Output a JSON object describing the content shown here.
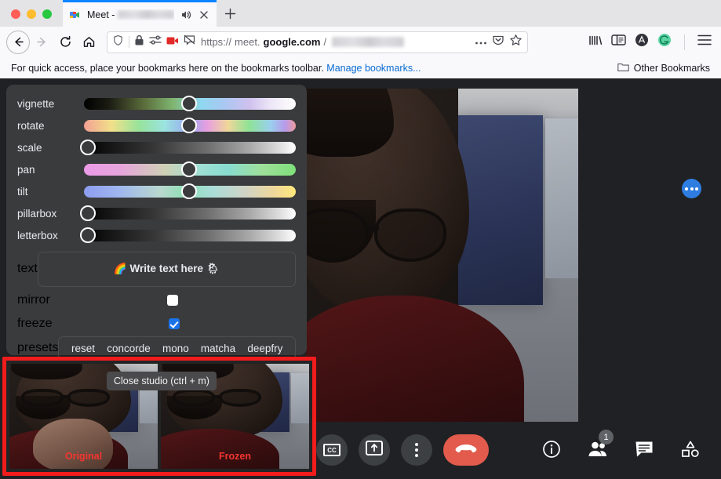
{
  "browser": {
    "tab": {
      "title": "Meet - ",
      "favicon": "google-meet-icon",
      "has_audio_playing": true
    },
    "newtab_label": "+",
    "url": {
      "scheme": "https://",
      "host_pre": "meet.",
      "host_bold": "google.com",
      "path": "/"
    },
    "url_icons": [
      "shield-icon",
      "lock-icon",
      "permissions-icon",
      "camera-blocked-icon",
      "popup-blocked-icon"
    ],
    "url_right_icons": [
      "more-icon",
      "pocket-icon",
      "bookmark-star-icon"
    ],
    "toolbar_icons": [
      "library-icon",
      "sidebar-icon",
      "account-icon",
      "grammarly-icon",
      "hamburger-menu-icon"
    ],
    "bookmarks_bar": {
      "text": "For quick access, place your bookmarks here on the bookmarks toolbar.",
      "link": "Manage bookmarks...",
      "other_bookmarks": "Other Bookmarks"
    }
  },
  "studio": {
    "sliders": [
      {
        "label": "vignette",
        "gradient": "g-vignette",
        "thumb_pct": 50
      },
      {
        "label": "rotate",
        "gradient": "g-rotate",
        "thumb_pct": 50
      },
      {
        "label": "scale",
        "gradient": "g-gray",
        "thumb_pct": 0
      },
      {
        "label": "pan",
        "gradient": "g-pan",
        "thumb_pct": 50
      },
      {
        "label": "tilt",
        "gradient": "g-tilt",
        "thumb_pct": 50
      },
      {
        "label": "pillarbox",
        "gradient": "g-gray",
        "thumb_pct": 0
      },
      {
        "label": "letterbox",
        "gradient": "g-gray",
        "thumb_pct": 0
      }
    ],
    "text": {
      "label": "text",
      "value": "",
      "placeholder": "🌈 Write text here 🌦"
    },
    "mirror": {
      "label": "mirror",
      "checked": false
    },
    "freeze": {
      "label": "freeze",
      "checked": true
    },
    "presets": {
      "label": "presets",
      "options": [
        "reset",
        "concorde",
        "mono",
        "matcha",
        "deepfry"
      ]
    }
  },
  "preview": {
    "tooltip": "Close studio (ctrl + m)",
    "left_label": "Original",
    "right_label": "Frozen",
    "border_color": "#f11c1c",
    "label_color": "#f4352f"
  },
  "meet": {
    "fab": "more-options-fab",
    "controls_left": [
      {
        "name": "captions-button",
        "icon": "cc-icon",
        "label": "CC"
      },
      {
        "name": "present-button",
        "icon": "present-screen-icon",
        "label": ""
      },
      {
        "name": "more-options-button",
        "icon": "three-dots-vertical-icon",
        "label": ""
      },
      {
        "name": "leave-call-button",
        "icon": "hangup-phone-icon",
        "label": ""
      }
    ],
    "controls_right": [
      {
        "name": "meeting-details-button",
        "icon": "info-icon",
        "badge": ""
      },
      {
        "name": "participants-button",
        "icon": "people-icon",
        "badge": "1"
      },
      {
        "name": "chat-button",
        "icon": "chat-bubble-icon",
        "badge": ""
      },
      {
        "name": "activities-button",
        "icon": "activities-shapes-icon",
        "badge": ""
      }
    ],
    "accent_red": "#e25b4d",
    "fab_blue": "#2f7de1"
  }
}
